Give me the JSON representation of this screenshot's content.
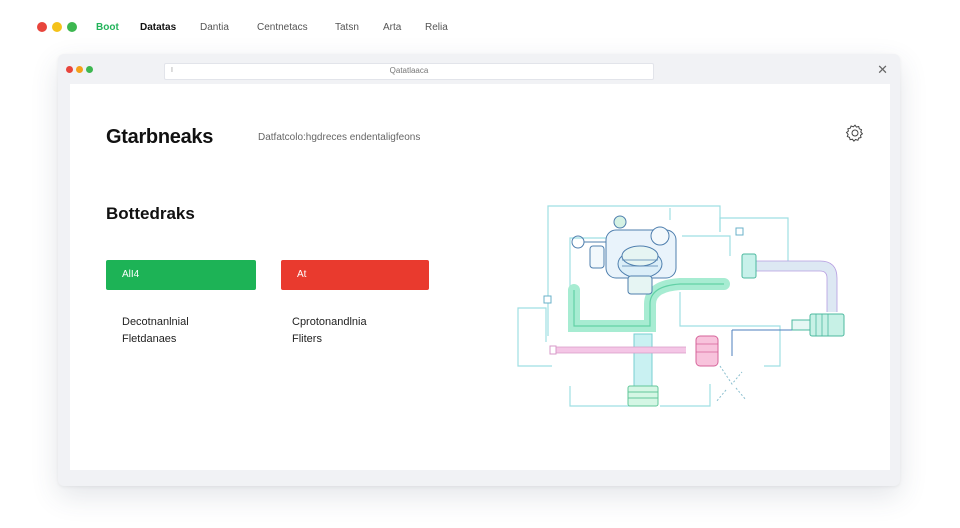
{
  "top_nav": {
    "items": [
      {
        "label": "Boot"
      },
      {
        "label": "Datatas"
      },
      {
        "label": "Dantia"
      },
      {
        "label": "Centnetacs"
      },
      {
        "label": "Tatsn"
      },
      {
        "label": "Arta"
      },
      {
        "label": "Relia"
      }
    ]
  },
  "window": {
    "address_bar": {
      "text": "Qatatlaaca",
      "cursor": "I"
    },
    "close_glyph": "✕"
  },
  "header": {
    "brand": "Gtarbneaks",
    "tagline": "Datfatcolo:hgdreces endentaligfeons"
  },
  "main": {
    "section_title": "Bottedraks",
    "primary_button_label": "AlI4",
    "danger_button_label": "At",
    "left_description": {
      "line1": "Decotnanlnial",
      "line2": "Fletdanaes"
    },
    "right_description": {
      "line1": "Cprotonandlnia",
      "line2": "Fliters"
    }
  },
  "icons": {
    "settings": "gear-icon",
    "illustration": "pipes-engine-illustration"
  },
  "colors": {
    "accent_green": "#1db356",
    "accent_red": "#e93a2e",
    "traffic_red": "#e8453c",
    "traffic_yellow": "#f4c21a",
    "traffic_green": "#3db750"
  }
}
